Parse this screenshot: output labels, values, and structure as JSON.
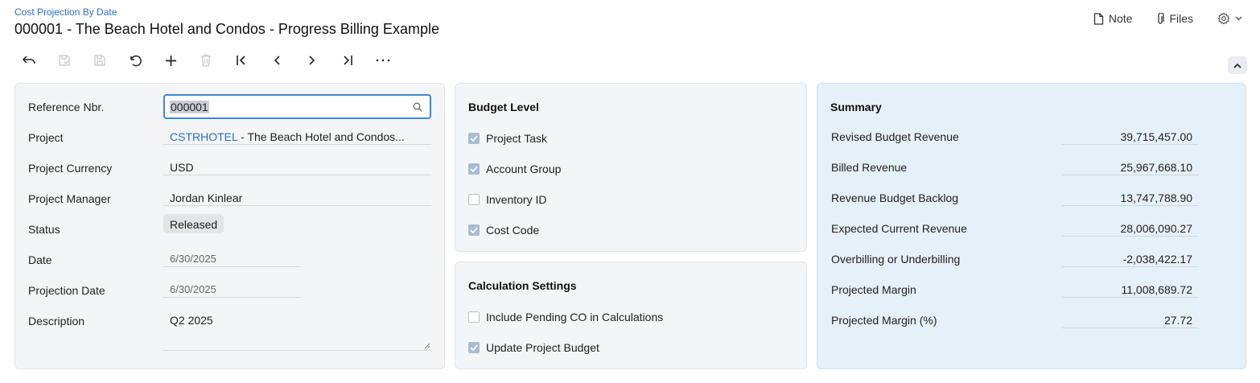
{
  "header": {
    "breadcrumb": "Cost Projection By Date",
    "title": "000001 - The Beach Hotel and Condos - Progress Billing Example"
  },
  "top_actions": {
    "note": "Note",
    "files": "Files"
  },
  "toolbar": {
    "items": [
      "back-icon",
      "save-close-icon",
      "save-icon",
      "undo-icon",
      "add-icon",
      "delete-icon",
      "first-record-icon",
      "previous-icon",
      "next-icon",
      "last-record-icon",
      "more-icon"
    ]
  },
  "form": {
    "reference_label": "Reference Nbr.",
    "reference_value": "000001",
    "project_label": "Project",
    "project_code": "CSTRHOTEL",
    "project_name": " - The Beach Hotel and Condos...",
    "currency_label": "Project Currency",
    "currency_value": "USD",
    "manager_label": "Project Manager",
    "manager_value": "Jordan Kinlear",
    "status_label": "Status",
    "status_value": "Released",
    "date_label": "Date",
    "date_value": "6/30/2025",
    "projection_date_label": "Projection Date",
    "projection_date_value": "6/30/2025",
    "description_label": "Description",
    "description_value": "Q2 2025"
  },
  "budget_level": {
    "title": "Budget Level",
    "items": [
      {
        "label": "Project Task",
        "checked": true
      },
      {
        "label": "Account Group",
        "checked": true
      },
      {
        "label": "Inventory ID",
        "checked": false
      },
      {
        "label": "Cost Code",
        "checked": true
      }
    ]
  },
  "calculation_settings": {
    "title": "Calculation Settings",
    "items": [
      {
        "label": "Include Pending CO in Calculations",
        "checked": false
      },
      {
        "label": "Update Project Budget",
        "checked": true
      }
    ]
  },
  "summary": {
    "title": "Summary",
    "rows": [
      {
        "label": "Revised Budget Revenue",
        "value": "39,715,457.00"
      },
      {
        "label": "Billed Revenue",
        "value": "25,967,668.10"
      },
      {
        "label": "Revenue Budget Backlog",
        "value": "13,747,788.90"
      },
      {
        "label": "Expected Current Revenue",
        "value": "28,006,090.27"
      },
      {
        "label": "Overbilling or Underbilling",
        "value": "-2,038,422.17"
      },
      {
        "label": "Projected Margin",
        "value": "11,008,689.72"
      },
      {
        "label": "Projected Margin (%)",
        "value": "27.72"
      }
    ]
  },
  "colors": {
    "accent": "#2f6fbf",
    "summary_bg": "#e6f0f8",
    "panel_bg": "#f4f5f7",
    "checkbox_on": "#a9bcd0"
  }
}
